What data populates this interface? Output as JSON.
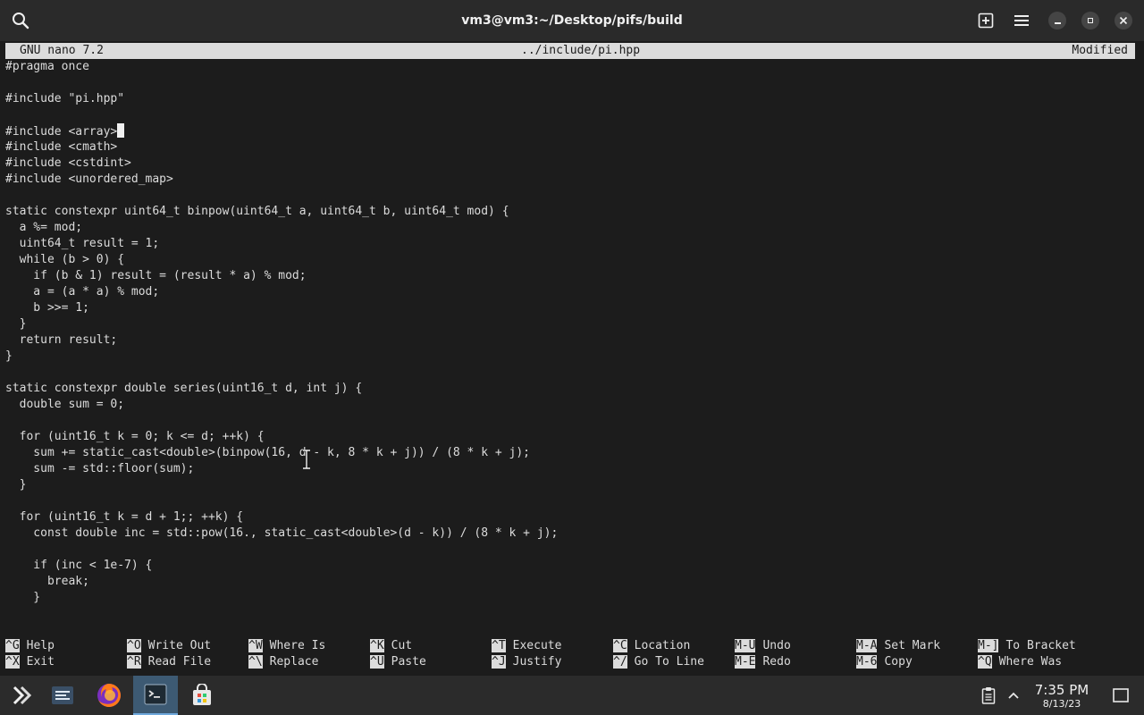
{
  "window": {
    "title": "vm3@vm3:~/Desktop/pifs/build"
  },
  "titlebar_icons": [
    "search-icon",
    "new-tab-icon",
    "menu-icon",
    "minimize-icon",
    "maximize-icon",
    "close-icon"
  ],
  "nano": {
    "version": "GNU nano 7.2",
    "filename": "../include/pi.hpp",
    "status": "Modified",
    "lines": [
      "#pragma once",
      "",
      "#include \"pi.hpp\"",
      "",
      "#include <array>",
      "#include <cmath>",
      "#include <cstdint>",
      "#include <unordered_map>",
      "",
      "static constexpr uint64_t binpow(uint64_t a, uint64_t b, uint64_t mod) {",
      "  a %= mod;",
      "  uint64_t result = 1;",
      "  while (b > 0) {",
      "    if (b & 1) result = (result * a) % mod;",
      "    a = (a * a) % mod;",
      "    b >>= 1;",
      "  }",
      "  return result;",
      "}",
      "",
      "static constexpr double series(uint16_t d, int j) {",
      "  double sum = 0;",
      "",
      "  for (uint16_t k = 0; k <= d; ++k) {",
      "    sum += static_cast<double>(binpow(16, d - k, 8 * k + j)) / (8 * k + j);",
      "    sum -= std::floor(sum);",
      "  }",
      "",
      "  for (uint16_t k = d + 1;; ++k) {",
      "    const double inc = std::pow(16., static_cast<double>(d - k)) / (8 * k + j);",
      "",
      "    if (inc < 1e-7) {",
      "      break;",
      "    }"
    ],
    "shortcuts": [
      [
        {
          "key": "^G",
          "label": "Help"
        },
        {
          "key": "^X",
          "label": "Exit"
        }
      ],
      [
        {
          "key": "^O",
          "label": "Write Out"
        },
        {
          "key": "^R",
          "label": "Read File"
        }
      ],
      [
        {
          "key": "^W",
          "label": "Where Is"
        },
        {
          "key": "^\\",
          "label": "Replace"
        }
      ],
      [
        {
          "key": "^K",
          "label": "Cut"
        },
        {
          "key": "^U",
          "label": "Paste"
        }
      ],
      [
        {
          "key": "^T",
          "label": "Execute"
        },
        {
          "key": "^J",
          "label": "Justify"
        }
      ],
      [
        {
          "key": "^C",
          "label": "Location"
        },
        {
          "key": "^/",
          "label": "Go To Line"
        }
      ],
      [
        {
          "key": "M-U",
          "label": "Undo"
        },
        {
          "key": "M-E",
          "label": "Redo"
        }
      ],
      [
        {
          "key": "M-A",
          "label": "Set Mark"
        },
        {
          "key": "M-6",
          "label": "Copy"
        }
      ],
      [
        {
          "key": "M-]",
          "label": "To Bracket"
        },
        {
          "key": "^Q",
          "label": "Where Was"
        }
      ]
    ]
  },
  "taskbar": {
    "items": [
      "app-launcher-icon",
      "system-settings-icon",
      "firefox-icon",
      "terminal-icon",
      "discover-store-icon"
    ],
    "tray": [
      "clipboard-icon",
      "tray-expand-icon",
      "show-desktop-icon"
    ],
    "time": "7:35 PM",
    "date": "8/13/23"
  },
  "colors": {
    "terminal_bg": "#1c1c1c",
    "text": "#dcdcdc",
    "bar_bg": "#dcdcdc",
    "titlebar_bg": "#2a2a2a",
    "taskbar_bg": "#2b2b2b",
    "active_task": "#3d5a73"
  }
}
